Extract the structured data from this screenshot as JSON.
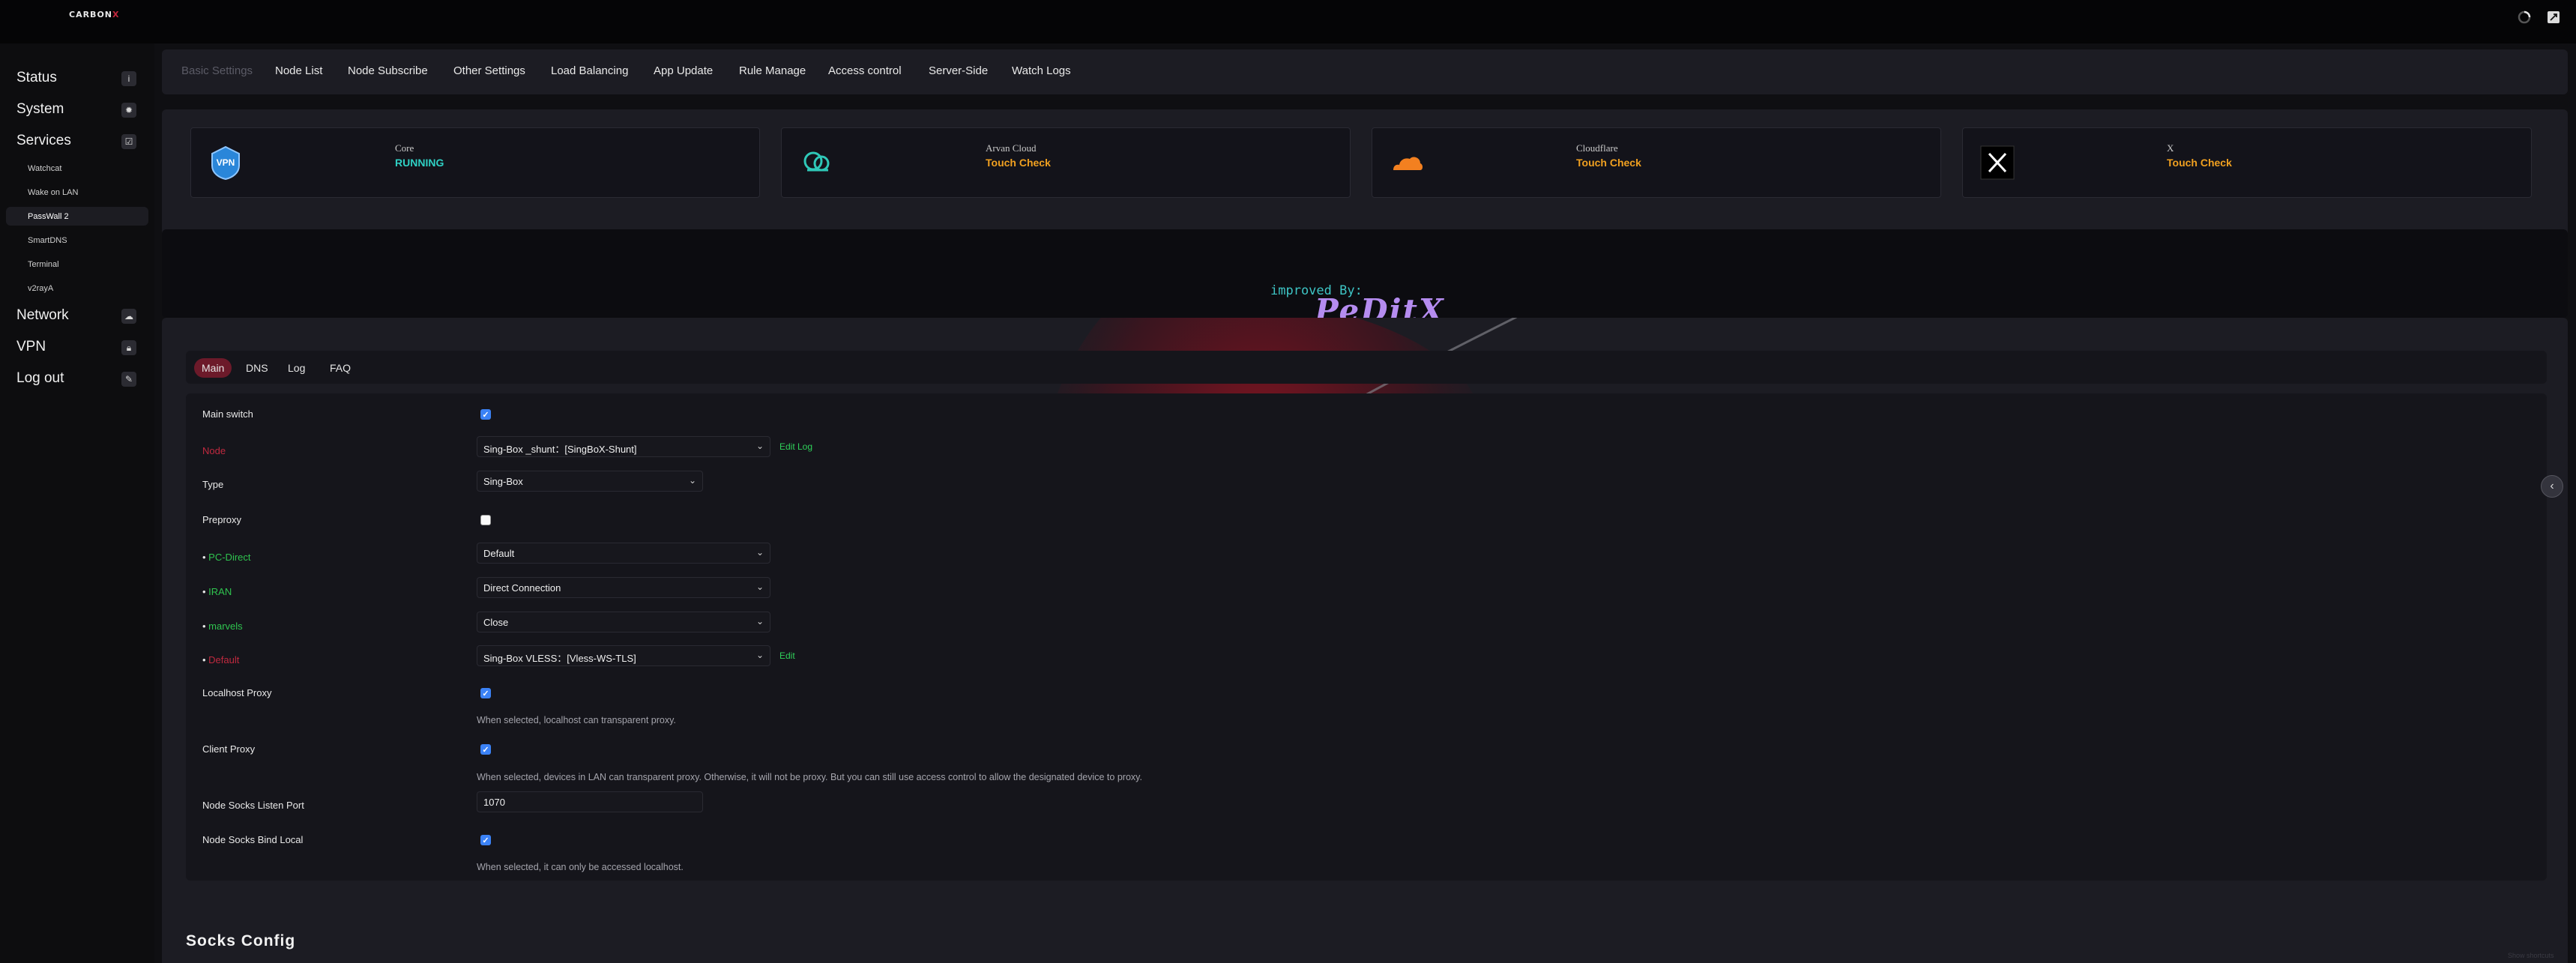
{
  "header": {
    "logo_main": "CARBON",
    "logo_x": "X",
    "spinner_icon": "loading-icon",
    "fullscreen_icon": "fullscreen-icon"
  },
  "sidebar": {
    "items": [
      {
        "label": "Status",
        "icon": "info-icon"
      },
      {
        "label": "System",
        "icon": "gear-icon"
      },
      {
        "label": "Services",
        "icon": "checkbox-icon"
      },
      {
        "label": "Network",
        "icon": "cloud-upload-icon"
      },
      {
        "label": "VPN",
        "icon": "lock-icon"
      },
      {
        "label": "Log out",
        "icon": "edit-icon"
      }
    ],
    "services_sub": [
      "Watchcat",
      "Wake on LAN",
      "PassWall 2",
      "SmartDNS",
      "Terminal",
      "v2rayA"
    ],
    "active_sub": "PassWall 2"
  },
  "top_tabs": [
    "Basic Settings",
    "Node List",
    "Node Subscribe",
    "Other Settings",
    "Load Balancing",
    "App Update",
    "Rule Manage",
    "Access control",
    "Server-Side",
    "Watch Logs"
  ],
  "status_cards": [
    {
      "label": "Core",
      "value": "RUNNING",
      "color": "#2fd0c4",
      "icon": "vpn-shield-icon"
    },
    {
      "label": "Arvan Cloud",
      "value": "Touch Check",
      "color": "#f0a020",
      "icon": "arvan-cloud-icon"
    },
    {
      "label": "Cloudflare",
      "value": "Touch Check",
      "color": "#f0a020",
      "icon": "cloudflare-icon"
    },
    {
      "label": "X",
      "value": "Touch Check",
      "color": "#f0a020",
      "icon": "x-logo-icon"
    }
  ],
  "banner": {
    "line1": "improved By:",
    "line2": "PeDitX"
  },
  "sub_tabs": [
    "Main",
    "DNS",
    "Log",
    "FAQ"
  ],
  "form": {
    "main_switch": {
      "label": "Main switch",
      "checked": true
    },
    "node": {
      "label": "Node",
      "value": "Sing-Box _shunt：[SingBoX-Shunt]",
      "edit": "Edit",
      "log": "Log"
    },
    "type": {
      "label": "Type",
      "value": "Sing-Box"
    },
    "preproxy": {
      "label": "Preproxy",
      "checked": false
    },
    "pc_direct": {
      "label": "PC-Direct",
      "value": "Default"
    },
    "iran": {
      "label": "IRAN",
      "value": "Direct Connection"
    },
    "marvels": {
      "label": "marvels",
      "value": "Close"
    },
    "default": {
      "label": "Default",
      "value": "Sing-Box VLESS：[Vless-WS-TLS]",
      "edit": "Edit"
    },
    "localhost_proxy": {
      "label": "Localhost Proxy",
      "checked": true,
      "hint": "When selected, localhost can transparent proxy."
    },
    "client_proxy": {
      "label": "Client Proxy",
      "checked": true,
      "hint": "When selected, devices in LAN can transparent proxy. Otherwise, it will not be proxy. But you can still use access control to allow the designated device to proxy."
    },
    "socks_port": {
      "label": "Node Socks Listen Port",
      "value": "1070"
    },
    "socks_bind_local": {
      "label": "Node Socks Bind Local",
      "checked": true,
      "hint": "When selected, it can only be accessed localhost."
    }
  },
  "sections": {
    "socks_config": "Socks Config"
  },
  "footer": {
    "watermark": "Show shortcuts"
  },
  "colors": {
    "accent_red": "#c0293f",
    "accent_green": "#2fc44f",
    "running_teal": "#2fd0c4",
    "touch_orange": "#f0a020"
  }
}
